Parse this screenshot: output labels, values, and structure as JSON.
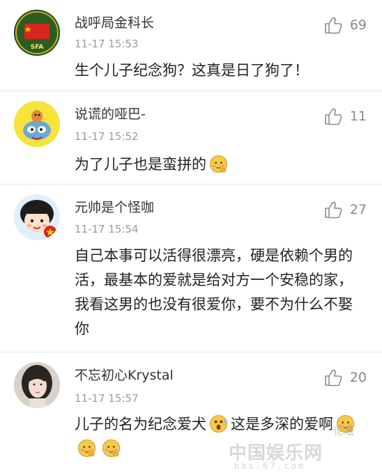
{
  "comments": [
    {
      "username": "战呼局金科长",
      "time": "11-17 15:53",
      "likes": "69",
      "text": "生个儿子纪念狗？这真是日了狗了！",
      "avatar": "sfa-flag-avatar",
      "avatar_text": "SFA"
    },
    {
      "username": "说谎的哑巴-",
      "time": "11-17 15:52",
      "likes": "11",
      "text": "为了儿子也是蛮拼的",
      "avatar": "cartoon-mouse-avatar"
    },
    {
      "username": "元帅是个怪咖",
      "time": "11-17 15:54",
      "likes": "27",
      "text": "自己本事可以活得很漂亮，硬是依赖个男的活，最基本的爱就是给对方一个安稳的家，我看这男的也没有很爱你，要不为什么不娶你",
      "avatar": "cartoon-girl-avatar"
    },
    {
      "username": "不忘初心Krystal",
      "time": "11-17 15:57",
      "likes": "20",
      "text_a": "儿子的名为纪念爱犬",
      "text_b": "这是多深的爱啊",
      "avatar": "woman-photo-avatar"
    }
  ],
  "icons": {
    "like": "thumbs-up-icon",
    "emoji_shy": "shy-face-emoji",
    "emoji_surprised": "surprised-face-emoji"
  },
  "watermark": {
    "site": "中国娱乐网",
    "url": "bbs.67.com",
    "tag": "论坛"
  },
  "colors": {
    "divider": "#e3e3e3",
    "muted": "#9b9b9b",
    "emoji": "#f7c948"
  }
}
